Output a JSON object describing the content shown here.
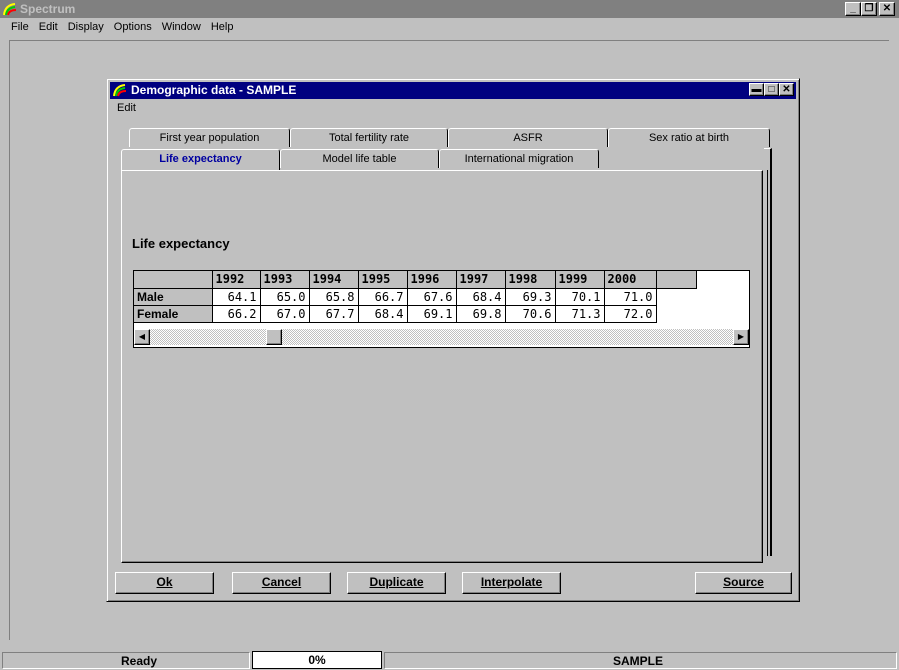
{
  "app": {
    "title": "Spectrum",
    "window_buttons": [
      "_",
      "❐",
      "✕"
    ]
  },
  "menubar": [
    "File",
    "Edit",
    "Display",
    "Options",
    "Window",
    "Help"
  ],
  "dialog": {
    "title": "Demographic data - SAMPLE",
    "window_buttons": [
      "▬",
      "□",
      "✕"
    ],
    "menu": "Edit",
    "tabs_row1": [
      "First year population",
      "Total fertility rate",
      "ASFR",
      "Sex ratio at birth"
    ],
    "tabs_row2": [
      "Life expectancy",
      "Model life table",
      "International migration"
    ],
    "active_tab": "Life expectancy",
    "section_label": "Life expectancy",
    "table": {
      "years": [
        "1992",
        "1993",
        "1994",
        "1995",
        "1996",
        "1997",
        "1998",
        "1999",
        "2000"
      ],
      "rows": [
        {
          "label": "Male",
          "values": [
            "64.1",
            "65.0",
            "65.8",
            "66.7",
            "67.6",
            "68.4",
            "69.3",
            "70.1",
            "71.0"
          ]
        },
        {
          "label": "Female",
          "values": [
            "66.2",
            "67.0",
            "67.7",
            "68.4",
            "69.1",
            "69.8",
            "70.6",
            "71.3",
            "72.0"
          ]
        }
      ]
    },
    "scroll": {
      "left_arrow": "◀",
      "right_arrow": "▶"
    },
    "buttons": {
      "ok": "Ok",
      "cancel": "Cancel",
      "duplicate": "Duplicate",
      "interpolate": "Interpolate",
      "source": "Source"
    }
  },
  "status": {
    "text": "Ready",
    "progress": "0%",
    "progress_value": 0,
    "project": "SAMPLE"
  }
}
